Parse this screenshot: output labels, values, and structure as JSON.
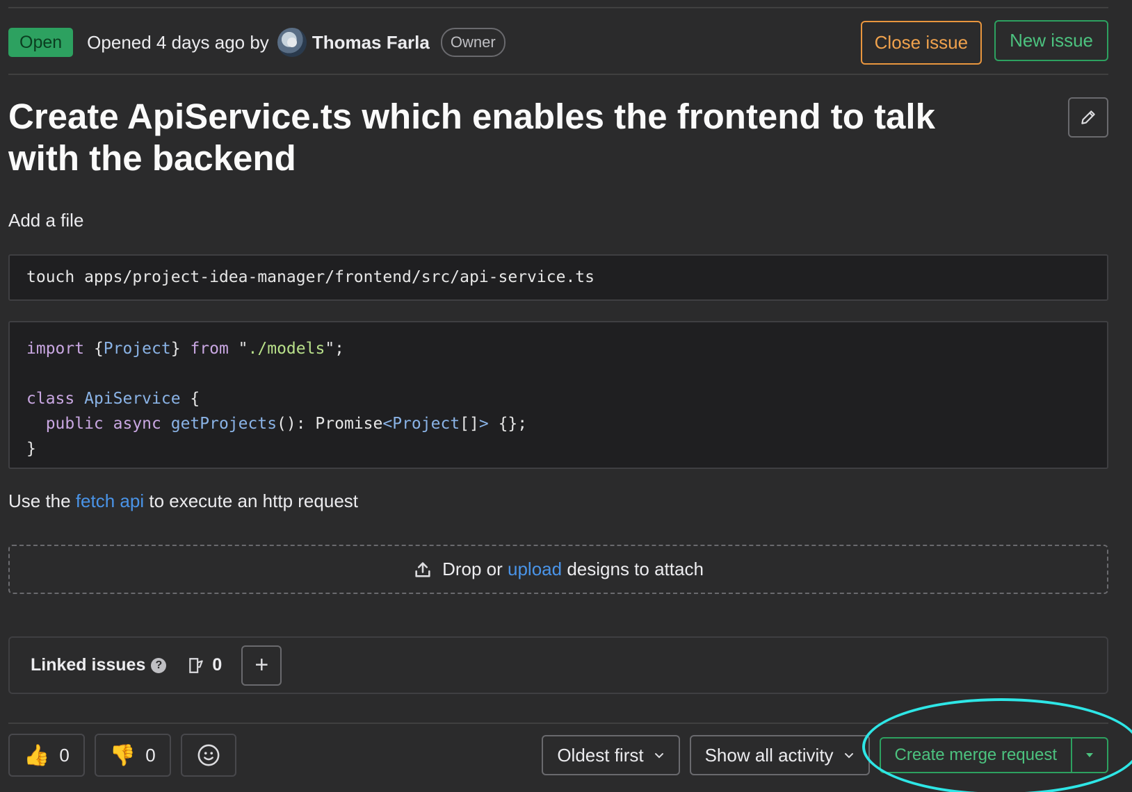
{
  "header": {
    "status": "Open",
    "opened_text": "Opened 4 days ago by",
    "author": "Thomas Farla",
    "role": "Owner",
    "close_label": "Close issue",
    "new_label": "New issue"
  },
  "issue": {
    "title": "Create ApiService.ts which enables the frontend to talk with the backend",
    "intro": "Add a file",
    "command": "touch apps/project-idea-manager/frontend/src/api-service.ts",
    "code": {
      "line1_kw1": "import",
      "line1_b1": " {",
      "line1_ty": "Project",
      "line1_b2": "} ",
      "line1_kw2": "from",
      "line1_q1": " \"",
      "line1_str": "./models",
      "line1_q2": "\";",
      "line3_kw": "class",
      "line3_ty": " ApiService",
      "line3_b": " {",
      "line4_kw1": "  public",
      "line4_kw2": " async",
      "line4_fn": " getProjects",
      "line4_p": "(): Promise",
      "line4_lt": "<",
      "line4_ty": "Project",
      "line4_arr": "[]",
      "line4_gt": ">",
      "line4_end": " {};",
      "line5": "}"
    },
    "fetch_pre": "Use the ",
    "fetch_link": "fetch api",
    "fetch_post": " to execute an http request"
  },
  "dropzone": {
    "pre": "Drop or ",
    "link": "upload",
    "post": " designs to attach"
  },
  "linked": {
    "title": "Linked issues",
    "count": "0",
    "add": "+"
  },
  "reactions": {
    "thumbs_up": "👍",
    "thumbs_up_count": "0",
    "thumbs_down": "👎",
    "thumbs_down_count": "0"
  },
  "toolbar": {
    "sort_label": "Oldest first",
    "filter_label": "Show all activity",
    "merge_label": "Create merge request"
  },
  "colors": {
    "open_badge": "#2da160",
    "close_accent": "#e9963e",
    "new_accent": "#2da160",
    "link": "#4a94e8",
    "highlight": "#2ee6e6"
  }
}
